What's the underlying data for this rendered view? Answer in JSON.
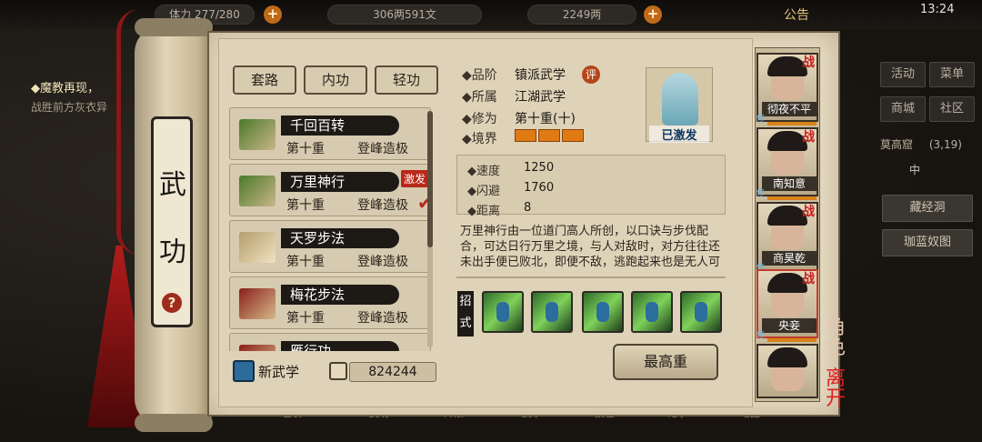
{
  "topbar": {
    "stamina": "体力 277/280",
    "money": "306两591文",
    "gold": "2249两",
    "notice": "公告",
    "clock": "13:24"
  },
  "quest": {
    "title": "◆魔教再现，",
    "desc": "战胜前方灰衣异"
  },
  "right_menu": {
    "huodong": "活动",
    "caidan": "菜单",
    "shangcheng": "商城",
    "shequ": "社区",
    "location": "莫高窟",
    "coords": "(3,19)",
    "compass": "中",
    "cangjingdong": "藏经洞",
    "jialan": "珈蓝奴图"
  },
  "scroll": {
    "title_1": "武",
    "title_2": "功",
    "help": "?"
  },
  "tabs": [
    "套路",
    "内功",
    "轻功"
  ],
  "list": [
    {
      "name": "千回百转",
      "level": "第十重",
      "status": "登峰造极",
      "badge": "",
      "checked": false
    },
    {
      "name": "万里神行",
      "level": "第十重",
      "status": "登峰造极",
      "badge": "激发",
      "checked": true
    },
    {
      "name": "天罗步法",
      "level": "第十重",
      "status": "登峰造极",
      "badge": "",
      "checked": false
    },
    {
      "name": "梅花步法",
      "level": "第十重",
      "status": "登峰造极",
      "badge": "",
      "checked": false
    },
    {
      "name": "雁行功",
      "level": "",
      "status": "",
      "badge": "",
      "checked": false
    }
  ],
  "new_skill": {
    "label": "新武学",
    "exp": "824244"
  },
  "detail": {
    "pinjie_label": "◆品阶",
    "pinjie": "镇派武学",
    "ping_icon": "评",
    "suoshu_label": "◆所属",
    "suoshu": "江湖武学",
    "xiuwei_label": "◆修为",
    "xiuwei": "第十重(十)",
    "jingjie_label": "◆境界",
    "jingjie_filled": 3,
    "activated": "已激发",
    "stats": [
      {
        "label": "◆速度",
        "value": "1250"
      },
      {
        "label": "◆闪避",
        "value": "1760"
      },
      {
        "label": "◆距离",
        "value": "8"
      }
    ],
    "description": "万里神行由一位道门高人所创，以口诀与步伐配合，可达日行万里之境，与人对敌时，对方往往还未出手便已败北，即便不敌，逃跑起来也是无人可望项背。",
    "zhaoshi": "招式",
    "max_button": "最高重"
  },
  "characters": [
    {
      "name": "彻夜不平",
      "tag": "战"
    },
    {
      "name": "南知意",
      "tag": "战"
    },
    {
      "name": "商昊乾",
      "tag": "战"
    },
    {
      "name": "央妾",
      "tag": "战"
    },
    {
      "name": "",
      "tag": ""
    }
  ],
  "char_badge": "修",
  "side_labels": {
    "jiaose": "角色",
    "likai": "离开"
  },
  "bottom_nav": [
    "背包",
    "包裹",
    "武功",
    "阵法",
    "武学",
    "技艺",
    "纪事",
    "地图"
  ]
}
